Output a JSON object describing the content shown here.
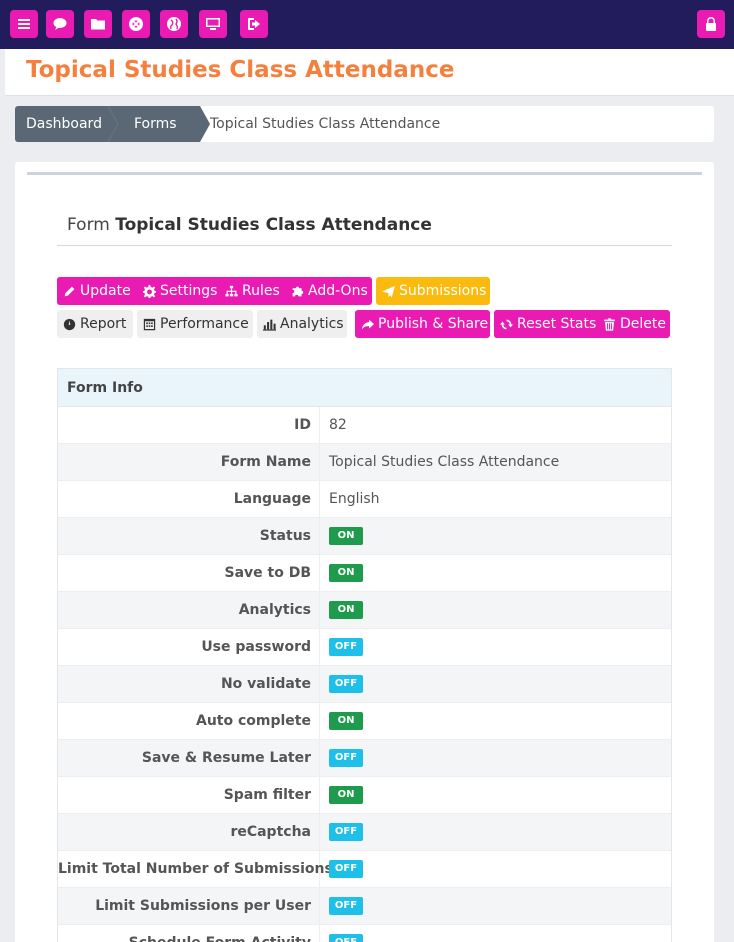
{
  "topbar": {
    "buttons": [
      {
        "icon": "menu-icon"
      },
      {
        "icon": "chat-icon"
      },
      {
        "icon": "folder-icon"
      },
      {
        "icon": "lifebuoy-icon"
      },
      {
        "icon": "globe-icon"
      },
      {
        "icon": "monitor-icon"
      },
      {
        "icon": "logout-icon"
      },
      {
        "icon": "lock-icon"
      }
    ],
    "color": "#231c5c",
    "accent": "#e91bb3"
  },
  "page": {
    "title": "Topical Studies Class Attendance",
    "title_color": "#f57f3d"
  },
  "breadcrumb": {
    "items": [
      "Dashboard",
      "Forms"
    ],
    "current": "Topical Studies Class Attendance"
  },
  "form": {
    "heading_prefix": "Form",
    "heading_name": "Topical Studies Class Attendance"
  },
  "actions": {
    "update": "Update",
    "settings": "Settings",
    "rules": "Rules",
    "addons": "Add-Ons",
    "submissions": "Submissions",
    "report": "Report",
    "performance": "Performance",
    "analytics": "Analytics",
    "publish": "Publish & Share",
    "reset": "Reset Stats",
    "delete": "Delete"
  },
  "info": {
    "title": "Form Info",
    "rows": [
      {
        "label": "ID",
        "value": "82"
      },
      {
        "label": "Form Name",
        "value": "Topical Studies Class Attendance"
      },
      {
        "label": "Language",
        "value": "English"
      },
      {
        "label": "Status",
        "value": "ON"
      },
      {
        "label": "Save to DB",
        "value": "ON"
      },
      {
        "label": "Analytics",
        "value": "ON"
      },
      {
        "label": "Use password",
        "value": "OFF"
      },
      {
        "label": "No validate",
        "value": "OFF"
      },
      {
        "label": "Auto complete",
        "value": "ON"
      },
      {
        "label": "Save & Resume Later",
        "value": "OFF"
      },
      {
        "label": "Spam filter",
        "value": "ON"
      },
      {
        "label": "reCaptcha",
        "value": "OFF"
      },
      {
        "label": "Limit Total Number of Submissions",
        "value": "OFF"
      },
      {
        "label": "Limit Submissions per User",
        "value": "OFF"
      },
      {
        "label": "Schedule Form Activity",
        "value": "OFF"
      }
    ]
  }
}
